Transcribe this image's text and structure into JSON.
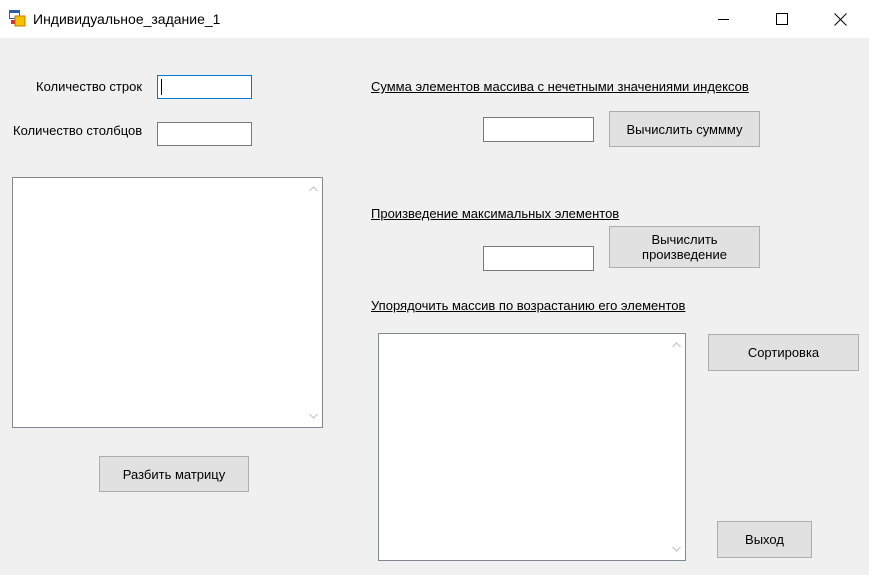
{
  "window": {
    "title": "Индивидуальное_задание_1",
    "controls": {
      "minimize_icon": "minimize-icon",
      "maximize_icon": "maximize-icon",
      "close_icon": "close-icon"
    }
  },
  "left_panel": {
    "rows_label": "Количество строк",
    "rows_value": "",
    "cols_label": "Количество столбцов",
    "cols_value": "",
    "split_button": "Разбить матрицу"
  },
  "right_panel": {
    "sum_label": "Сумма элементов массива с нечетными значениями индексов",
    "sum_value": "",
    "sum_button": "Вычислить суммму",
    "product_label": "Произведение максимальных элементов",
    "product_value": "",
    "product_button_line1": "Вычислить",
    "product_button_line2": "произведение",
    "sort_label": "Упорядочить массив по возрастанию его элементов",
    "sort_button": "Сортировка",
    "exit_button": "Выход"
  },
  "colors": {
    "focus_border": "#0078d7",
    "button_bg": "#e1e1e1",
    "form_bg": "#f0f0f0"
  }
}
